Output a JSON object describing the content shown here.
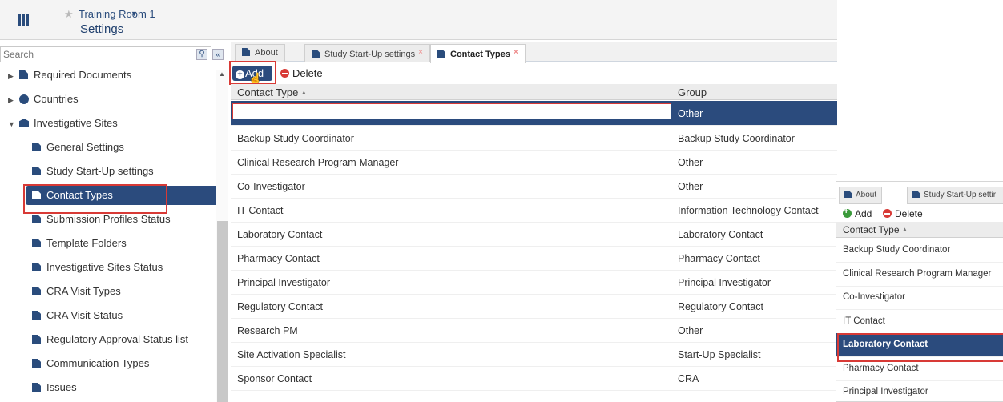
{
  "header": {
    "room": "Training Room 1",
    "title": "Settings"
  },
  "sidebar": {
    "search_placeholder": "Search",
    "items": [
      {
        "label": "Required Documents",
        "level": 0,
        "expander": "▶",
        "icon": "checklist-icon"
      },
      {
        "label": "Countries",
        "level": 0,
        "expander": "▶",
        "icon": "globe-icon"
      },
      {
        "label": "Investigative Sites",
        "level": 0,
        "expander": "▼",
        "icon": "building-icon"
      },
      {
        "label": "General Settings",
        "level": 1,
        "icon": "document-icon"
      },
      {
        "label": "Study Start-Up settings",
        "level": 1,
        "icon": "document-icon"
      },
      {
        "label": "Contact Types",
        "level": 1,
        "icon": "document-icon",
        "selected": true
      },
      {
        "label": "Submission Profiles Status",
        "level": 1,
        "icon": "document-icon"
      },
      {
        "label": "Template Folders",
        "level": 1,
        "icon": "document-icon"
      },
      {
        "label": "Investigative Sites Status",
        "level": 1,
        "icon": "document-icon"
      },
      {
        "label": "CRA Visit Types",
        "level": 1,
        "icon": "document-icon"
      },
      {
        "label": "CRA Visit Status",
        "level": 1,
        "icon": "document-icon"
      },
      {
        "label": "Regulatory Approval Status list",
        "level": 1,
        "icon": "document-icon"
      },
      {
        "label": "Communication Types",
        "level": 1,
        "icon": "document-icon"
      },
      {
        "label": "Issues",
        "level": 1,
        "icon": "document-icon"
      }
    ]
  },
  "tabs": [
    {
      "label": "About"
    },
    {
      "label": "Study Start-Up settings",
      "closable": true
    },
    {
      "label": "Contact Types",
      "closable": true,
      "active": true
    }
  ],
  "toolbar": {
    "add_label": "Add",
    "delete_label": "Delete"
  },
  "grid": {
    "columns": [
      "Contact Type",
      "Group"
    ],
    "new_row_group": "Other",
    "rows": [
      {
        "type": "Backup Study Coordinator",
        "group": "Backup Study Coordinator"
      },
      {
        "type": "Clinical Research Program Manager",
        "group": "Other"
      },
      {
        "type": "Co-Investigator",
        "group": "Other"
      },
      {
        "type": "IT Contact",
        "group": "Information Technology Contact"
      },
      {
        "type": "Laboratory Contact",
        "group": "Laboratory Contact"
      },
      {
        "type": "Pharmacy Contact",
        "group": "Pharmacy Contact"
      },
      {
        "type": "Principal Investigator",
        "group": "Principal Investigator"
      },
      {
        "type": "Regulatory Contact",
        "group": "Regulatory Contact"
      },
      {
        "type": "Research PM",
        "group": "Other"
      },
      {
        "type": "Site Activation Specialist",
        "group": "Start-Up Specialist"
      },
      {
        "type": "Sponsor Contact",
        "group": "CRA"
      }
    ]
  },
  "inset": {
    "tabs": [
      "About",
      "Study Start-Up settir"
    ],
    "add_label": "Add",
    "delete_label": "Delete",
    "column": "Contact Type",
    "rows": [
      "Backup Study Coordinator",
      "Clinical Research Program Manager",
      "Co-Investigator",
      "IT Contact",
      "Laboratory Contact",
      "Pharmacy Contact",
      "Principal Investigator"
    ],
    "selected_index": 4
  },
  "colors": {
    "accent": "#2b4b7d",
    "highlight": "#d83a36"
  }
}
